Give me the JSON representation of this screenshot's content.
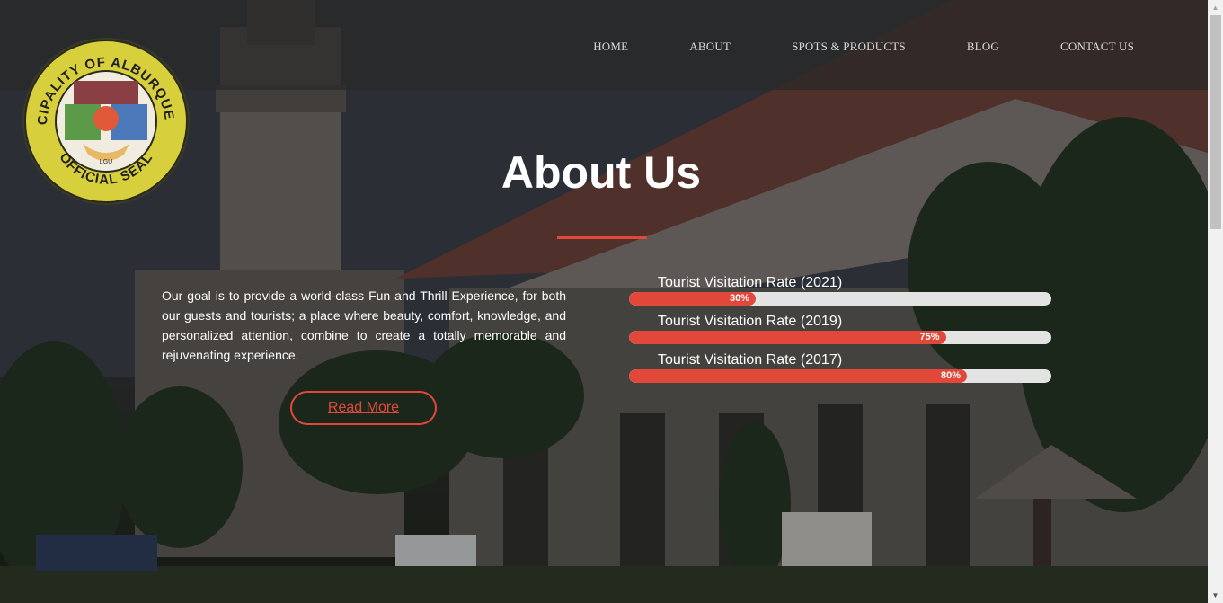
{
  "nav": {
    "items": [
      "HOME",
      "ABOUT",
      "SPOTS & PRODUCTS",
      "BLOG",
      "CONTACT US"
    ]
  },
  "seal": {
    "text_top": "MUNICIPALITY OF ALBURQUERQUE",
    "text_bottom": "OFFICIAL SEAL",
    "mark": "LGU"
  },
  "about": {
    "title": "About Us",
    "body": "Our goal is to provide a world-class Fun and Thrill Experience, for both our guests and tourists; a place where beauty, comfort, knowledge, and personalized attention, combine to create a totally memorable and rejuvenating experience.",
    "read_more": "Read More"
  },
  "stats": [
    {
      "label": "Tourist Visitation Rate (2021)",
      "value": 30,
      "display": "30%"
    },
    {
      "label": "Tourist Visitation Rate (2019)",
      "value": 75,
      "display": "75%"
    },
    {
      "label": "Tourist Visitation Rate (2017)",
      "value": 80,
      "display": "80%"
    }
  ],
  "colors": {
    "accent": "#e2483a",
    "track": "#e3e3e3",
    "header_bg": "#282828"
  },
  "background": "church-photo"
}
